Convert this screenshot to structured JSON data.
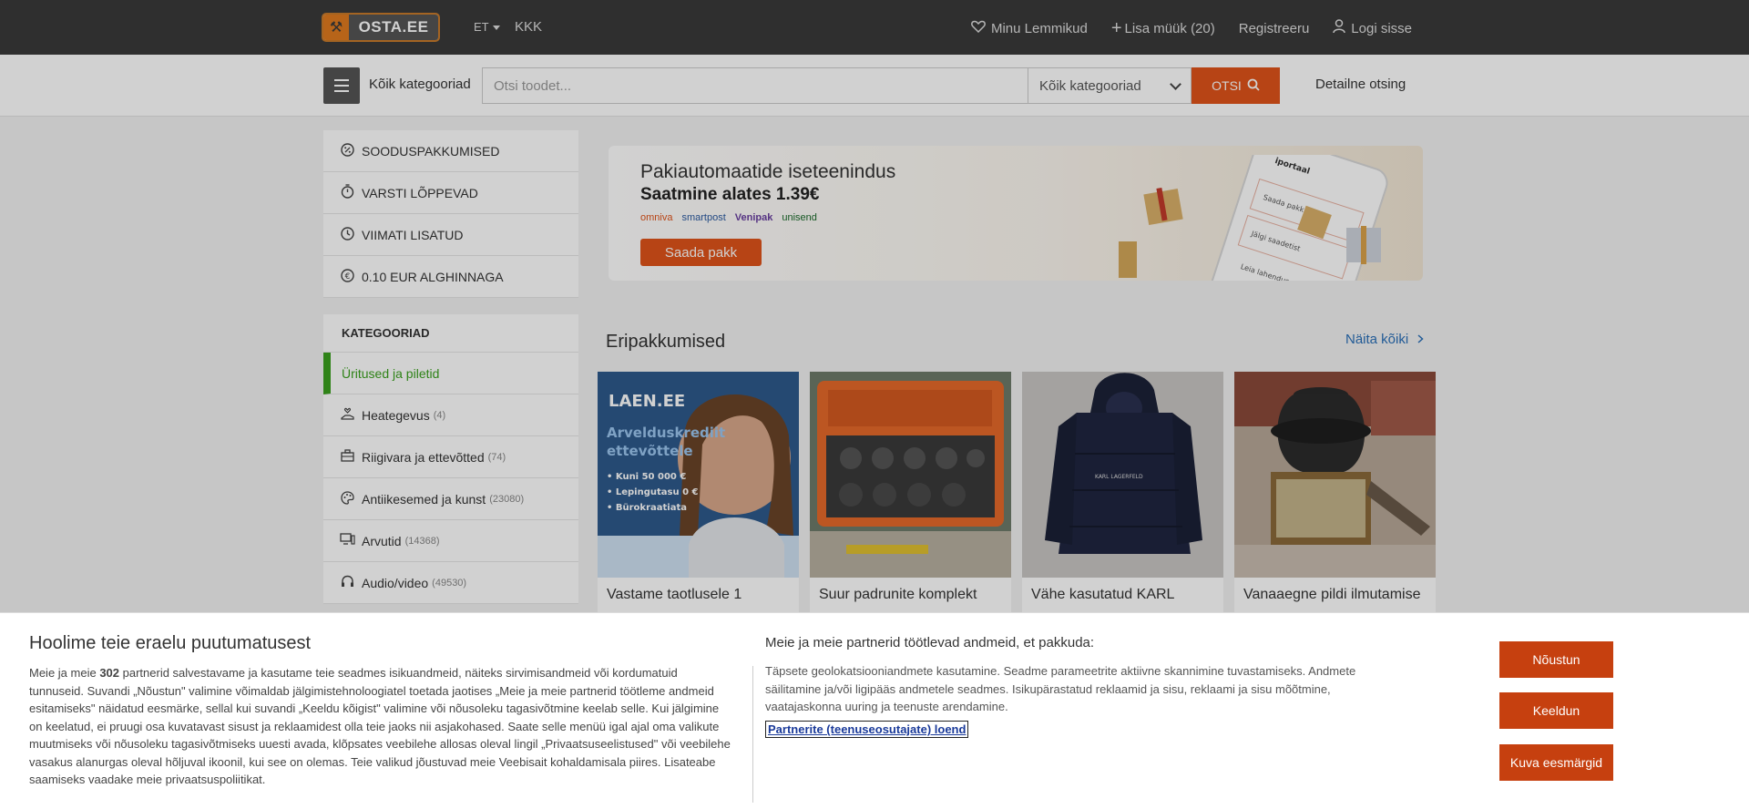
{
  "header": {
    "logo_text": "OSTA.EE",
    "lang": "ET",
    "faq": "KKK",
    "nav": {
      "favorites": "Minu Lemmikud",
      "add_sale": "Lisa müük (20)",
      "register": "Registreeru",
      "login": "Logi sisse"
    }
  },
  "search": {
    "all_categories_label": "Kõik kategooriad",
    "placeholder": "Otsi toodet...",
    "category_select": "Kõik kategooriad",
    "button": "OTSI",
    "detailed": "Detailne otsing"
  },
  "sidebar": {
    "quick": [
      {
        "label": "SOODUSPAKKUMISED",
        "icon": "discount-icon"
      },
      {
        "label": "VARSTI LÕPPEVAD",
        "icon": "stopwatch-icon"
      },
      {
        "label": "VIIMATI LISATUD",
        "icon": "clock-icon"
      },
      {
        "label": "0.10 EUR ALGHINNAGA",
        "icon": "euro-icon"
      }
    ],
    "categories_heading": "KATEGOORIAD",
    "categories": [
      {
        "label": "Üritused ja piletid",
        "count": ""
      },
      {
        "label": "Heategevus",
        "count": "(4)"
      },
      {
        "label": "Riigivara ja ettevõtted",
        "count": "(74)"
      },
      {
        "label": "Antiikesemed ja kunst",
        "count": "(23080)"
      },
      {
        "label": "Arvutid",
        "count": "(14368)"
      },
      {
        "label": "Audio/video",
        "count": "(49530)"
      }
    ]
  },
  "banner": {
    "title": "Pakiautomaatide iseteenindus",
    "subtitle": "Saatmine alates 1.39€",
    "carriers": [
      "omniva",
      "smartpost",
      "Venipak",
      "unisend"
    ],
    "button": "Saada pakk",
    "phone_texts": [
      "iportaal",
      "Saada pakk",
      "Jälgi saadetist",
      "Leia lahendus"
    ]
  },
  "offers": {
    "title": "Eripakkumised",
    "see_all": "Näita kõiki",
    "cards": [
      {
        "title": "Vastame taotlusele 1",
        "img_lines": [
          "LAEN.EE",
          "Arvelduskrediit",
          "ettevõttele",
          "• Kuni 50 000 €",
          "• Lepingutasu 0 €",
          "• Bürokraatiata"
        ]
      },
      {
        "title": "Suur padrunite komplekt"
      },
      {
        "title": "Vähe kasutatud KARL",
        "img_lines": [
          "KARL LAGERFELD"
        ]
      },
      {
        "title": "Vanaaegne pildi ilmutamise"
      }
    ]
  },
  "consent": {
    "title": "Hoolime teie eraelu puutumatusest",
    "body_prefix": "Meie ja meie ",
    "partners_count": "302",
    "body_rest": " partnerid salvestavame ja kasutame teie seadmes isikuandmeid, näiteks sirvimisandmeid või kordumatuid tunnuseid. Suvandi „Nõustun\" valimine võimaldab jälgimistehnoloogiatel toetada jaotises „Meie ja meie partnerid töötleme andmeid esitamiseks\" näidatud eesmärke, sellal kui suvandi „Keeldu kõigist\" valimine või nõusoleku tagasivõtmine keelab selle. Kui jälgimine on keelatud, ei pruugi osa kuvatavast sisust ja reklaamidest olla teie jaoks nii asjakohased. Saate selle menüü igal ajal oma valikute muutmiseks või nõusoleku tagasivõtmiseks uuesti avada, klõpsates veebilehe allosas oleval lingil „Privaatsuseelistused\" või veebilehe vasakus alanurgas oleval hõljuval ikoonil, kui see on olemas. Teie valikud jõustuvad meie Veebisait kohaldamisala piires. Lisateabe saamiseks vaadake meie privaatsuspoliitikat.",
    "purposes_title": "Meie ja meie partnerid töötlevad andmeid, et pakkuda:",
    "purposes_body": "Täpsete geolokatsiooniandmete kasutamine. Seadme parameetrite aktiivne skannimine tuvastamiseks. Andmete säilitamine ja/või ligipääs andmetele seadmes. Isikupärastatud reklaamid ja sisu, reklaami ja sisu mõõtmine, vaatajaskonna uuring ja teenuste arendamine.",
    "partners_link": "Partnerite (teenuseosutajate) loend",
    "btn_accept": "Nõustun",
    "btn_reject": "Keeldun",
    "btn_purposes": "Kuva eesmärgid"
  },
  "colors": {
    "accent": "#e0541a",
    "consent_button": "#c6400f",
    "active_category": "#3aa01e",
    "topbar": "#3a3a3a"
  }
}
